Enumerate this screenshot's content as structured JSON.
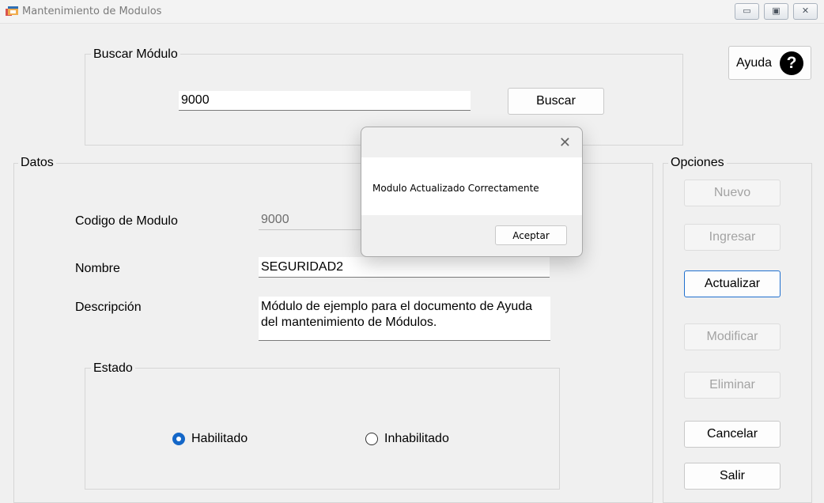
{
  "window": {
    "title": "Mantenimiento de Modulos",
    "controls": {
      "minimize": "▭",
      "maximize": "▣",
      "close": "✕"
    }
  },
  "buscar": {
    "group_title": "Buscar Módulo",
    "input_value": "9000",
    "button_label": "Buscar"
  },
  "ayuda": {
    "label": "Ayuda",
    "icon_glyph": "?"
  },
  "datos": {
    "group_title": "Datos",
    "codigo_label": "Codigo de Modulo",
    "codigo_value": "9000",
    "nombre_label": "Nombre",
    "nombre_value": "SEGURIDAD2",
    "descripcion_label": "Descripción",
    "descripcion_value": "Módulo de ejemplo para el documento de Ayuda del mantenimiento de Módulos.",
    "estado": {
      "group_title": "Estado",
      "habilitado_label": "Habilitado",
      "inhabilitado_label": "Inhabilitado",
      "selected": "Habilitado"
    }
  },
  "opciones": {
    "group_title": "Opciones",
    "nuevo": "Nuevo",
    "ingresar": "Ingresar",
    "actualizar": "Actualizar",
    "modificar": "Modificar",
    "eliminar": "Eliminar",
    "cancelar": "Cancelar",
    "salir": "Salir"
  },
  "dialog": {
    "message": "Modulo Actualizado Correctamente",
    "accept_label": "Aceptar",
    "close_glyph": "✕"
  },
  "colors": {
    "accent_blue": "#1467c8",
    "window_bg": "#f0f0f0",
    "disabled_text": "#a3a3a3"
  }
}
